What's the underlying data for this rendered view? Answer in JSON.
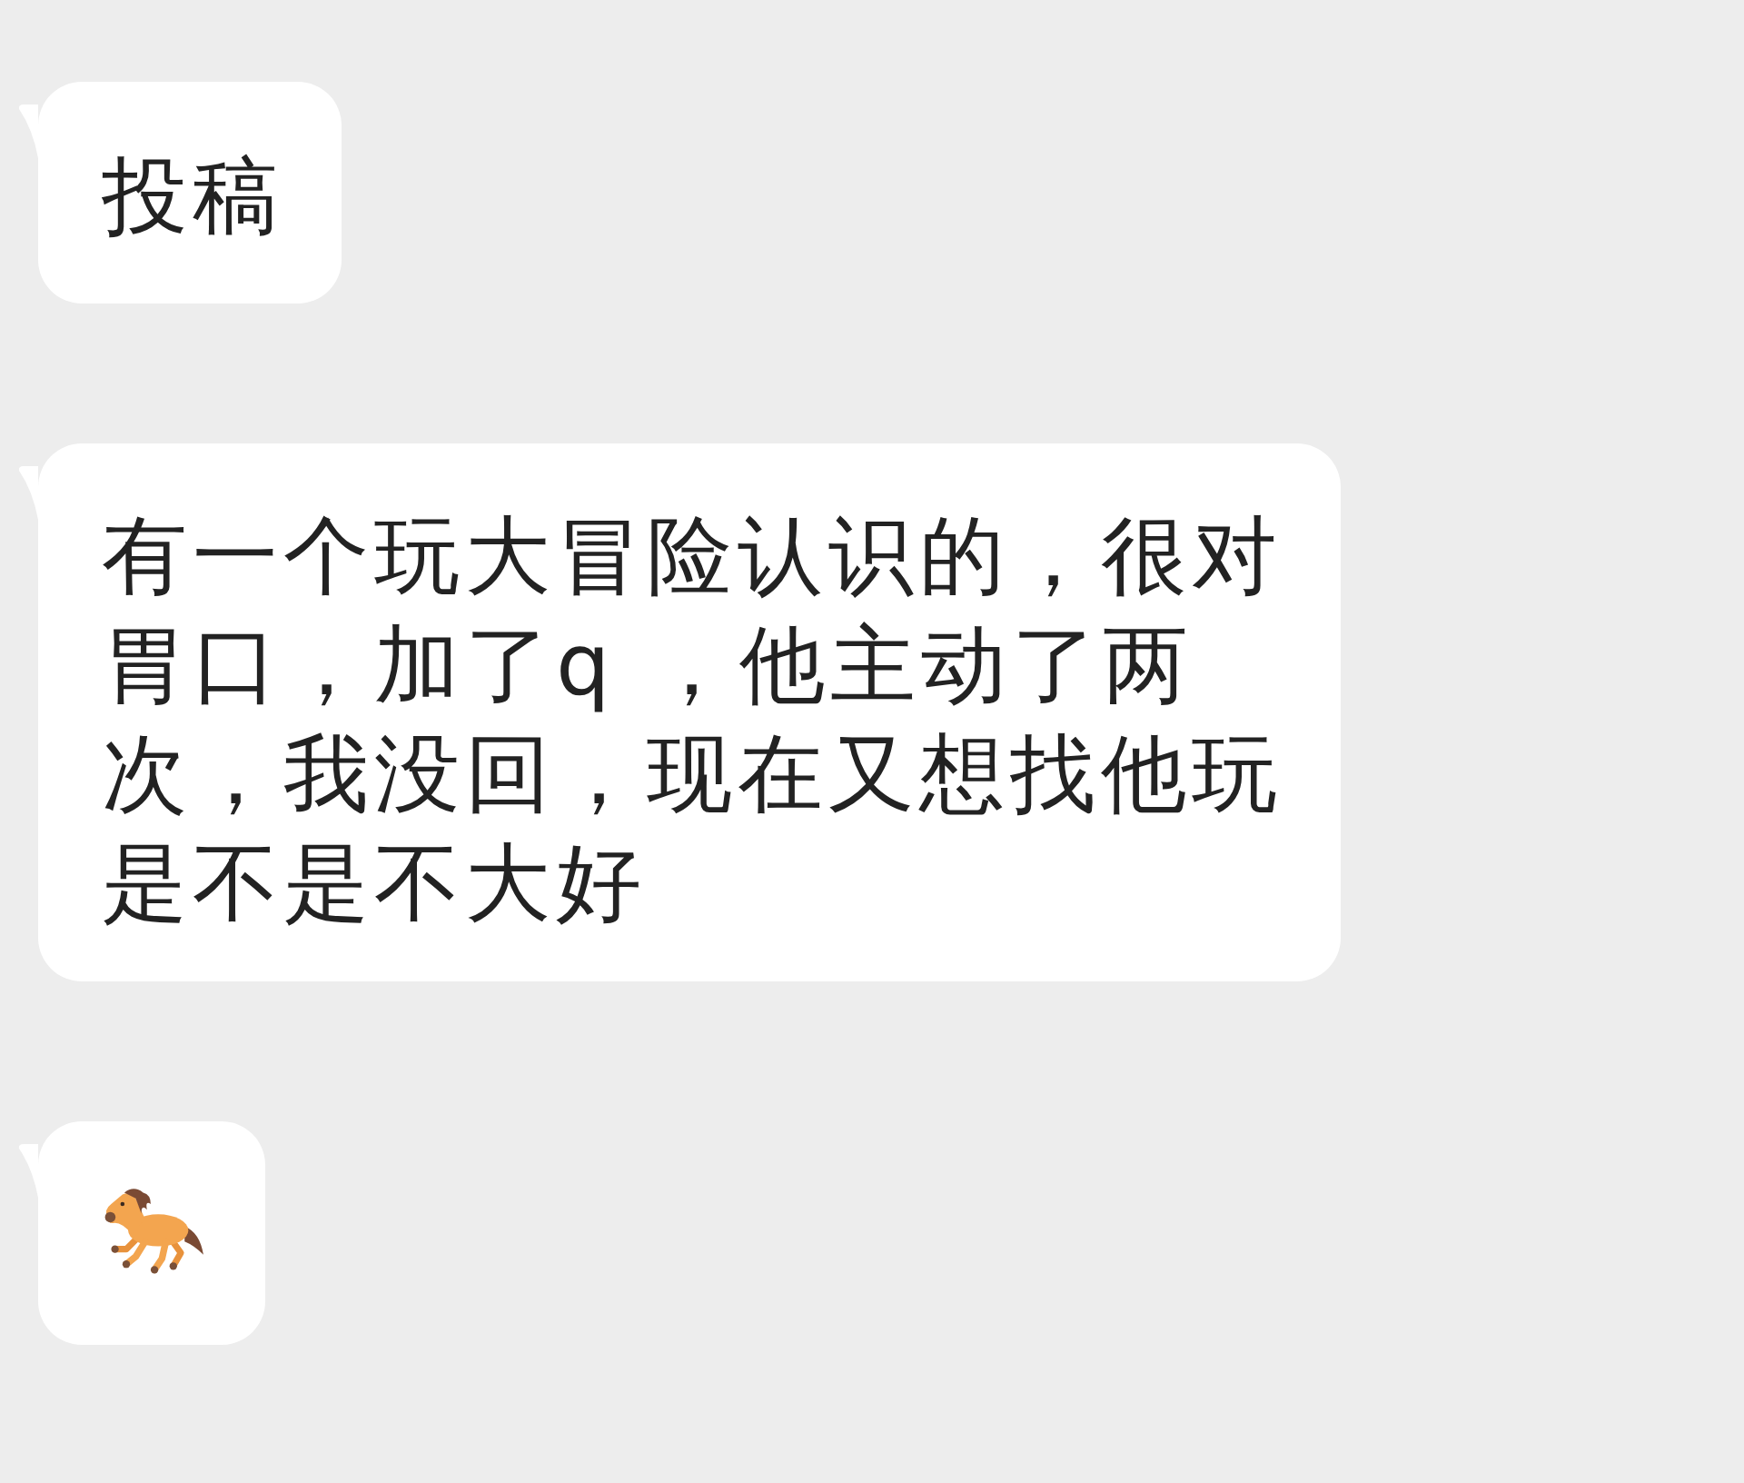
{
  "messages": [
    {
      "kind": "text",
      "text": "投稿"
    },
    {
      "kind": "text",
      "text": "有一个玩大冒险认识的，很对胃口，加了q ，他主动了两次，我没回，现在又想找他玩是不是不大好"
    },
    {
      "kind": "emoji"
    }
  ]
}
